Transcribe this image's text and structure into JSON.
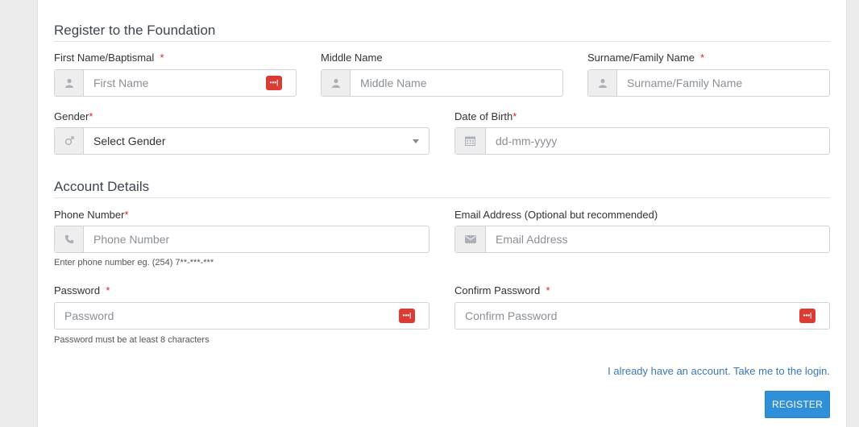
{
  "sections": {
    "register_title": "Register to the Foundation",
    "account_title": "Account Details"
  },
  "fields": {
    "first_name": {
      "label": "First Name/Baptismal",
      "required": "*",
      "placeholder": "First Name"
    },
    "middle_name": {
      "label": "Middle Name",
      "placeholder": "Middle Name"
    },
    "surname": {
      "label": "Surname/Family Name",
      "required": "*",
      "placeholder": "Surname/Family Name"
    },
    "gender": {
      "label": "Gender",
      "required": "*",
      "selected": "Select Gender"
    },
    "dob": {
      "label": "Date of Birth",
      "required": "*",
      "placeholder": "dd-mm-yyyy"
    },
    "phone": {
      "label": "Phone Number",
      "required": "*",
      "placeholder": "Phone Number",
      "help": "Enter phone number eg. (254) 7**-***-***"
    },
    "email": {
      "label": "Email Address (Optional but recommended)",
      "placeholder": "Email Address"
    },
    "password": {
      "label": "Password",
      "required": "*",
      "placeholder": "Password",
      "help": "Password must be at least 8 characters"
    },
    "confirm_password": {
      "label": "Confirm Password",
      "required": "*",
      "placeholder": "Confirm Password"
    }
  },
  "password_manager_badge": "•••|",
  "login_link": "I already have an account. Take me to the login.",
  "register_button": "REGISTER",
  "colors": {
    "accent": "#2f8fd8",
    "required": "#d9252d",
    "link": "#3a77b7",
    "pw_badge": "#dc3b32"
  }
}
